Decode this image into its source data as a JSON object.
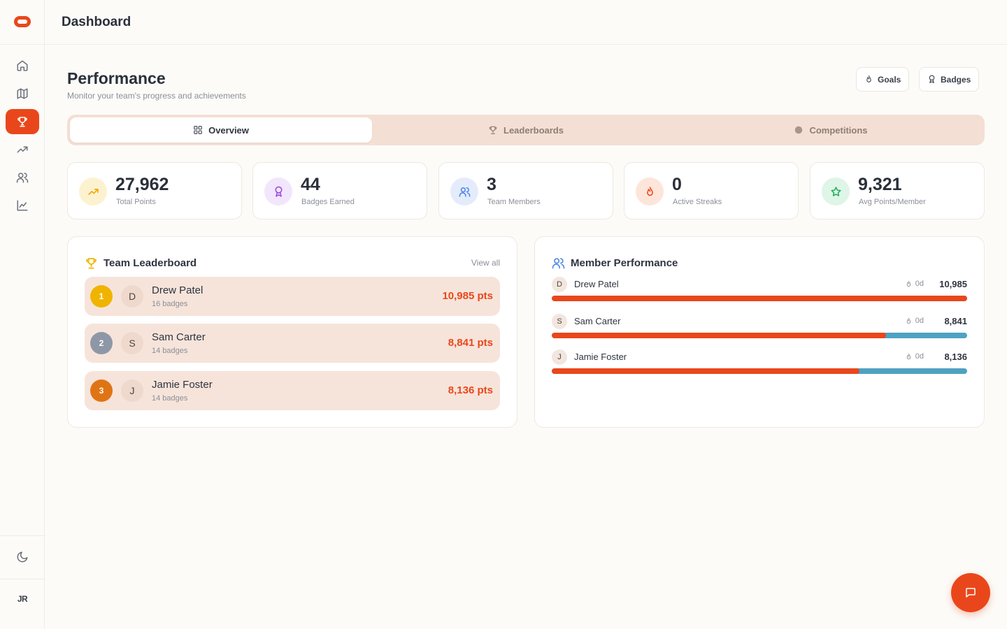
{
  "app": {
    "header_title": "Dashboard",
    "user_initials": "JR"
  },
  "page": {
    "title": "Performance",
    "subtitle": "Monitor your team's progress and achievements",
    "buttons": {
      "goals": "Goals",
      "badges": "Badges"
    }
  },
  "tabs": [
    {
      "label": "Overview",
      "active": true
    },
    {
      "label": "Leaderboards",
      "active": false
    },
    {
      "label": "Competitions",
      "active": false
    }
  ],
  "stats": [
    {
      "value": "27,962",
      "label": "Total Points",
      "icon": "trending-up-icon",
      "color": "#f0a500",
      "bg": "#fdf2d0"
    },
    {
      "value": "44",
      "label": "Badges Earned",
      "icon": "award-icon",
      "color": "#9b4ddb",
      "bg": "#f1e6fb"
    },
    {
      "value": "3",
      "label": "Team Members",
      "icon": "users-icon",
      "color": "#4f86e8",
      "bg": "#e4ecfb"
    },
    {
      "value": "0",
      "label": "Active Streaks",
      "icon": "flame-icon",
      "color": "#e9471b",
      "bg": "#fde5da"
    },
    {
      "value": "9,321",
      "label": "Avg Points/Member",
      "icon": "star-icon",
      "color": "#23b05a",
      "bg": "#dff5e7"
    }
  ],
  "leaderboard": {
    "title": "Team Leaderboard",
    "view_all": "View all",
    "rows": [
      {
        "rank": "1",
        "initial": "D",
        "name": "Drew Patel",
        "badges": "16 badges",
        "points": "10,985 pts",
        "rank_color": "#f0b400"
      },
      {
        "rank": "2",
        "initial": "S",
        "name": "Sam Carter",
        "badges": "14 badges",
        "points": "8,841 pts",
        "rank_color": "#8e97a6"
      },
      {
        "rank": "3",
        "initial": "J",
        "name": "Jamie Foster",
        "badges": "14 badges",
        "points": "8,136 pts",
        "rank_color": "#e07414"
      }
    ]
  },
  "member_performance": {
    "title": "Member Performance",
    "rows": [
      {
        "initial": "D",
        "name": "Drew Patel",
        "streak": "0d",
        "points": "10,985",
        "progress": 1.0
      },
      {
        "initial": "S",
        "name": "Sam Carter",
        "streak": "0d",
        "points": "8,841",
        "progress": 0.805
      },
      {
        "initial": "J",
        "name": "Jamie Foster",
        "streak": "0d",
        "points": "8,136",
        "progress": 0.741
      }
    ]
  },
  "colors": {
    "accent": "#e9471b",
    "bar_track": "#4ea2c2"
  }
}
